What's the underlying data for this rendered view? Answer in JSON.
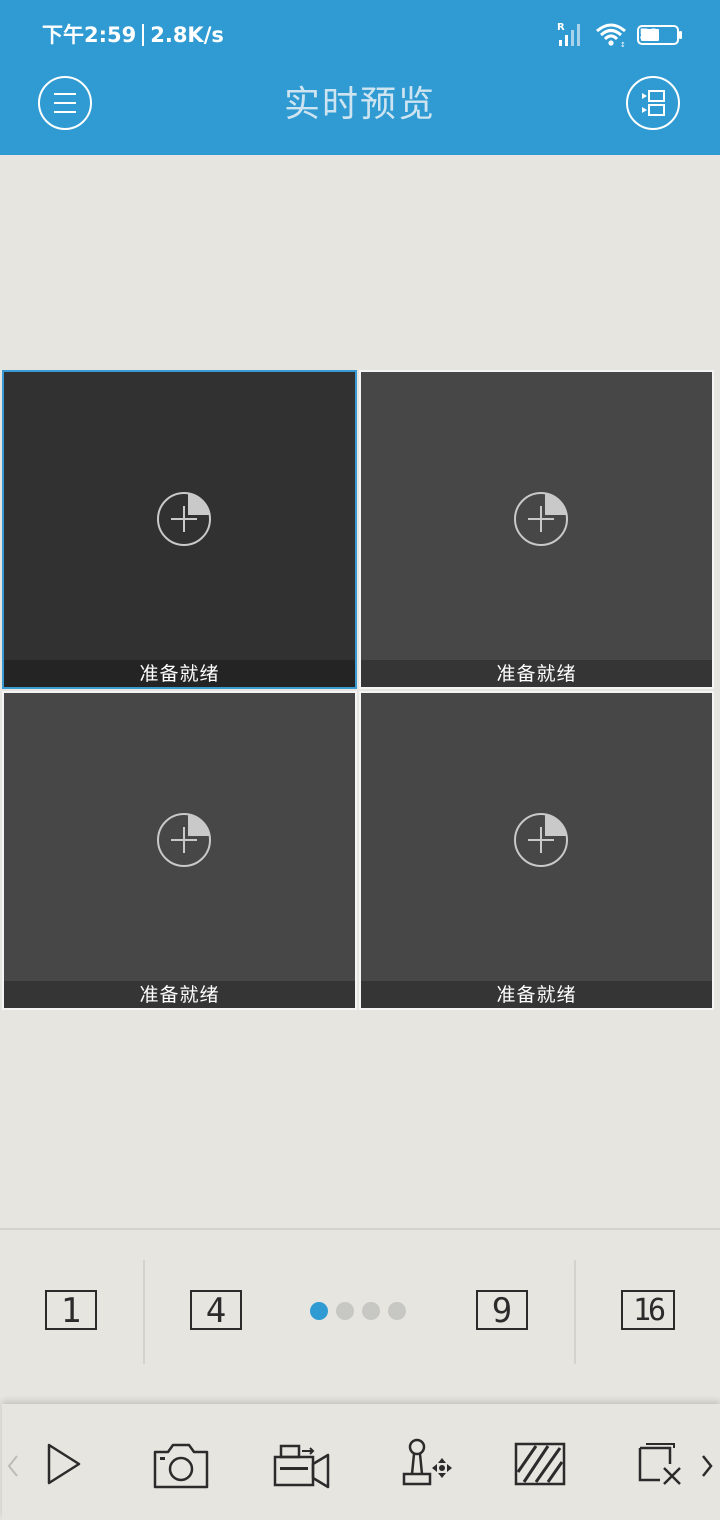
{
  "status_bar": {
    "time": "下午2:59",
    "net_speed": "2.8K/s",
    "signal_badge": "R",
    "battery": "51",
    "icons": [
      "signal-icon",
      "wifi-icon",
      "battery-icon"
    ]
  },
  "header": {
    "title": "实时预览",
    "left_icon": "menu-icon",
    "right_icon": "device-list-icon",
    "color": "#2f9bd2"
  },
  "grid": {
    "selected_color": "#3a9bd3",
    "cells": [
      {
        "status": "准备就绪",
        "selected": true
      },
      {
        "status": "准备就绪",
        "selected": false
      },
      {
        "status": "准备就绪",
        "selected": false
      },
      {
        "status": "准备就绪",
        "selected": false
      }
    ]
  },
  "split_options": {
    "labels": [
      "1",
      "4",
      "9",
      "16"
    ],
    "page_count": 4,
    "active_page": 1
  },
  "toolbar": {
    "tools": [
      "play-icon",
      "camera-icon",
      "record-icon",
      "ptz-joystick-icon",
      "quality-icon",
      "close-all-icon"
    ],
    "nav": [
      "chevron-left-icon",
      "chevron-right-icon"
    ]
  }
}
